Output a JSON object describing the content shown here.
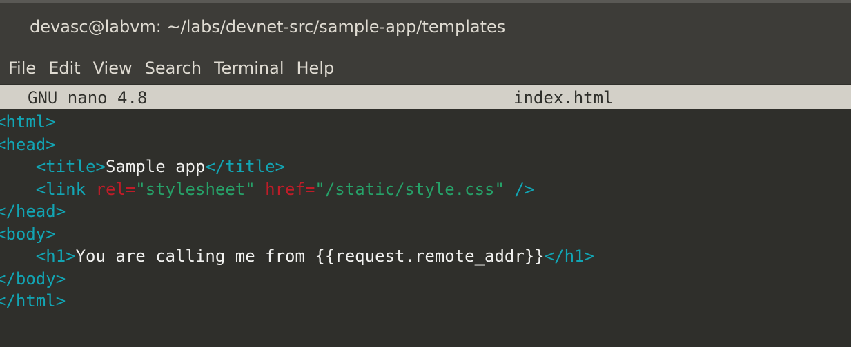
{
  "window": {
    "title": "devasc@labvm: ~/labs/devnet-src/sample-app/templates"
  },
  "menu": {
    "items": [
      "File",
      "Edit",
      "View",
      "Search",
      "Terminal",
      "Help"
    ]
  },
  "nano": {
    "version": "GNU nano 4.8",
    "filename": "index.html"
  },
  "code": {
    "html_open": "<html>",
    "head_open": "<head>",
    "title_open": "<title>",
    "title_text": "Sample app",
    "title_close": "</title>",
    "link_open": "<link",
    "rel_attr": "rel=",
    "rel_value": "\"stylesheet\"",
    "href_attr": "href=",
    "href_value": "\"/static/style.css\"",
    "link_close": "/>",
    "head_close": "</head>",
    "body_open": "<body>",
    "h1_open": "<h1>",
    "h1_text": "You are calling me from {{request.remote_addr}}",
    "h1_close": "</h1>",
    "body_close": "</body>",
    "html_close": "</html>"
  },
  "colors": {
    "tag": "#12a5b4",
    "attribute": "#c01c28",
    "string": "#26a269",
    "text": "#f1f1ef",
    "background": "#2f2f2b",
    "nano_bar": "#d3d0c8"
  }
}
